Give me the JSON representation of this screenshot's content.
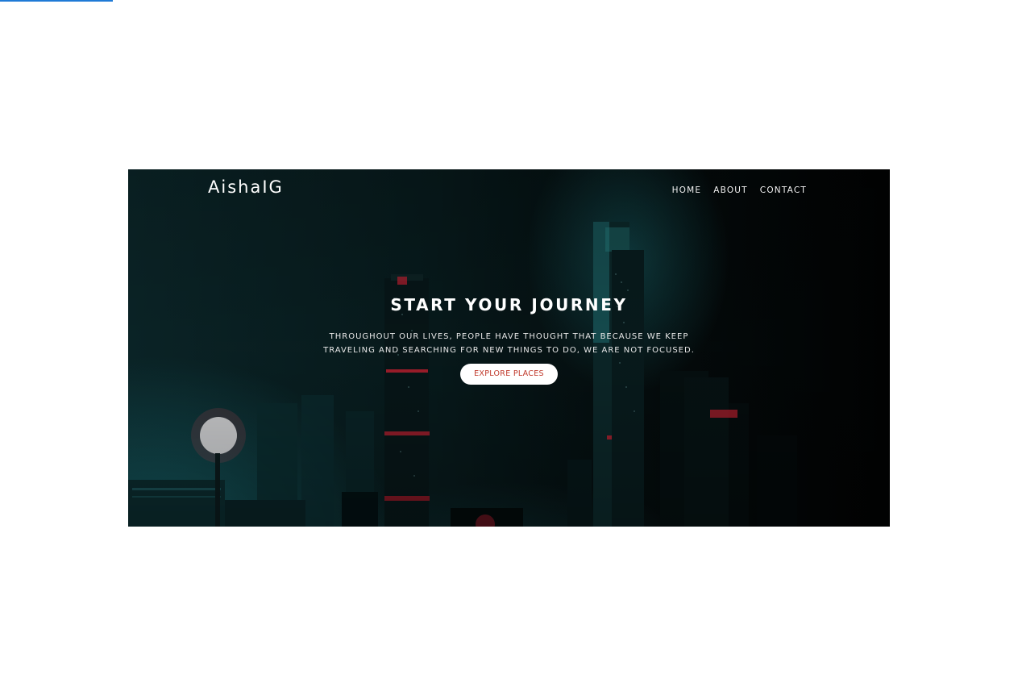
{
  "brand": {
    "name": "AishaIG"
  },
  "nav": {
    "links": [
      "HOME",
      "ABOUT",
      "CONTACT"
    ]
  },
  "hero": {
    "title": "START YOUR JOURNEY",
    "text": "THROUGHOUT OUR LIVES, PEOPLE HAVE THOUGHT THAT BECAUSE WE KEEP TRAVELING AND SEARCHING FOR NEW THINGS TO DO, WE ARE NOT FOCUSED.",
    "cta_label": "EXPLORE PLACES",
    "background_description_icon": "night-city-skyline-image"
  },
  "colors": {
    "accent_line": "#1f7ad6",
    "cta_text": "#c0392b",
    "cta_bg": "#ffffff",
    "hero_bg": "#071a1c"
  }
}
